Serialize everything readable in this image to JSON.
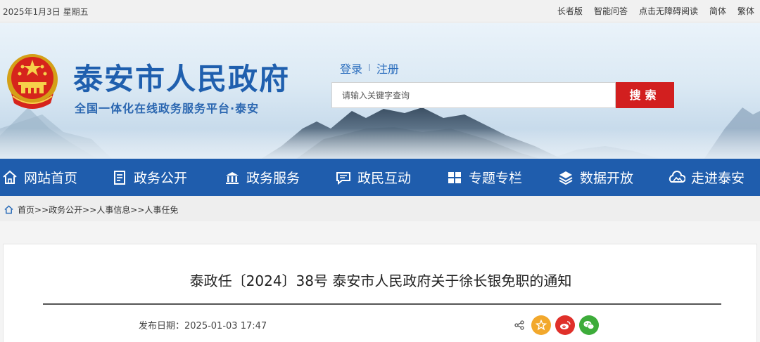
{
  "topbar": {
    "date": "2025年1月3日 星期五",
    "links": [
      "长者版",
      "智能问答",
      "点击无障碍阅读",
      "简体",
      "繁体"
    ]
  },
  "header": {
    "title": "泰安市人民政府",
    "subtitle": "全国一体化在线政务服务平台·泰安",
    "login": "登录",
    "separator": "I",
    "register": "注册",
    "search_placeholder": "请输入关键字查询",
    "search_button": "搜索"
  },
  "nav": {
    "items": [
      {
        "label": "网站首页",
        "icon": "home-icon"
      },
      {
        "label": "政务公开",
        "icon": "document-icon"
      },
      {
        "label": "政务服务",
        "icon": "government-building-icon"
      },
      {
        "label": "政民互动",
        "icon": "chat-icon"
      },
      {
        "label": "专题专栏",
        "icon": "book-icon"
      },
      {
        "label": "数据开放",
        "icon": "layers-icon"
      },
      {
        "label": "走进泰安",
        "icon": "cloud-mountain-icon"
      }
    ]
  },
  "breadcrumb": {
    "items": [
      "首页",
      "政务公开",
      "人事信息",
      "人事任免"
    ],
    "separator": ">>"
  },
  "article": {
    "title": "泰政任〔2024〕38号 泰安市人民政府关于徐长银免职的通知",
    "date_label": "发布日期：",
    "date_value": "2025-01-03 17:47"
  },
  "colors": {
    "nav_bg": "#1f5dad",
    "title_blue": "#1f5fae",
    "search_red": "#d21f1f",
    "star": "#f2a82c",
    "weibo": "#e0302a",
    "wechat": "#3dac3a"
  }
}
